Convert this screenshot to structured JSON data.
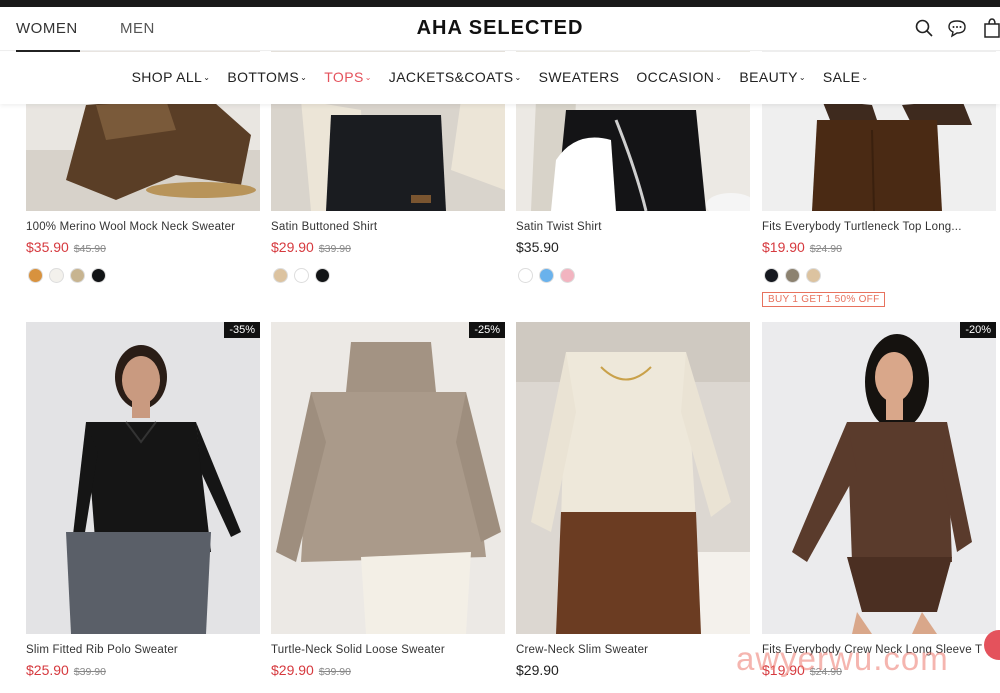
{
  "header": {
    "genders": [
      "WOMEN",
      "MEN"
    ],
    "logo": "AHA SELECTED",
    "icons": [
      "search-icon",
      "chat-icon",
      "bag-icon"
    ]
  },
  "nav": [
    {
      "label": "SHOP ALL",
      "caret": "⌄"
    },
    {
      "label": "BOTTOMS",
      "caret": "⌄"
    },
    {
      "label": "TOPS",
      "caret": "⌄",
      "active": true
    },
    {
      "label": "JACKETS&COATS",
      "caret": "⌄"
    },
    {
      "label": "SWEATERS",
      "caret": ""
    },
    {
      "label": "OCCASION",
      "caret": "⌄"
    },
    {
      "label": "BEAUTY",
      "caret": "⌄"
    },
    {
      "label": "SALE",
      "caret": "⌄"
    }
  ],
  "products_row1": [
    {
      "title": "100% Merino Wool Mock Neck Sweater",
      "price": "$35.90",
      "old_price": "$45.90",
      "swatches": [
        "#d8923e",
        "#f3f1ec",
        "#c7b490",
        "#121416"
      ]
    },
    {
      "title": "Satin Buttoned Shirt",
      "price": "$29.90",
      "old_price": "$39.90",
      "swatches": [
        "#dcc3a0",
        "#ffffff",
        "#121416"
      ]
    },
    {
      "title": "Satin Twist Shirt",
      "price": "$35.90",
      "old_price": "",
      "swatches": [
        "#ffffff",
        "#6ab2ec",
        "#f2b4c0"
      ]
    },
    {
      "title": "Fits Everybody Turtleneck Top Long...",
      "price": "$19.90",
      "old_price": "$24.90",
      "swatches": [
        "#15181f",
        "#8c8270",
        "#dcc3a0"
      ],
      "promo": "BUY 1 GET 1   50% OFF"
    }
  ],
  "products_row2": [
    {
      "title": "Slim Fitted Rib Polo Sweater",
      "price": "$25.90",
      "old_price": "$39.90",
      "badge": "-35%"
    },
    {
      "title": "Turtle-Neck Solid Loose Sweater",
      "price": "$29.90",
      "old_price": "$39.90",
      "badge": "-25%"
    },
    {
      "title": "Crew-Neck Slim Sweater",
      "price": "$29.90",
      "old_price": "",
      "badge": ""
    },
    {
      "title": "Fits Everybody Crew Neck Long Sleeve T",
      "price": "$19.90",
      "old_price": "$24.90",
      "badge": "-20%"
    }
  ],
  "watermark": "awyerwu.com",
  "colors": {
    "accent": "#e4525c",
    "sale_price": "#d63a3f",
    "promo": "#e7725e"
  }
}
